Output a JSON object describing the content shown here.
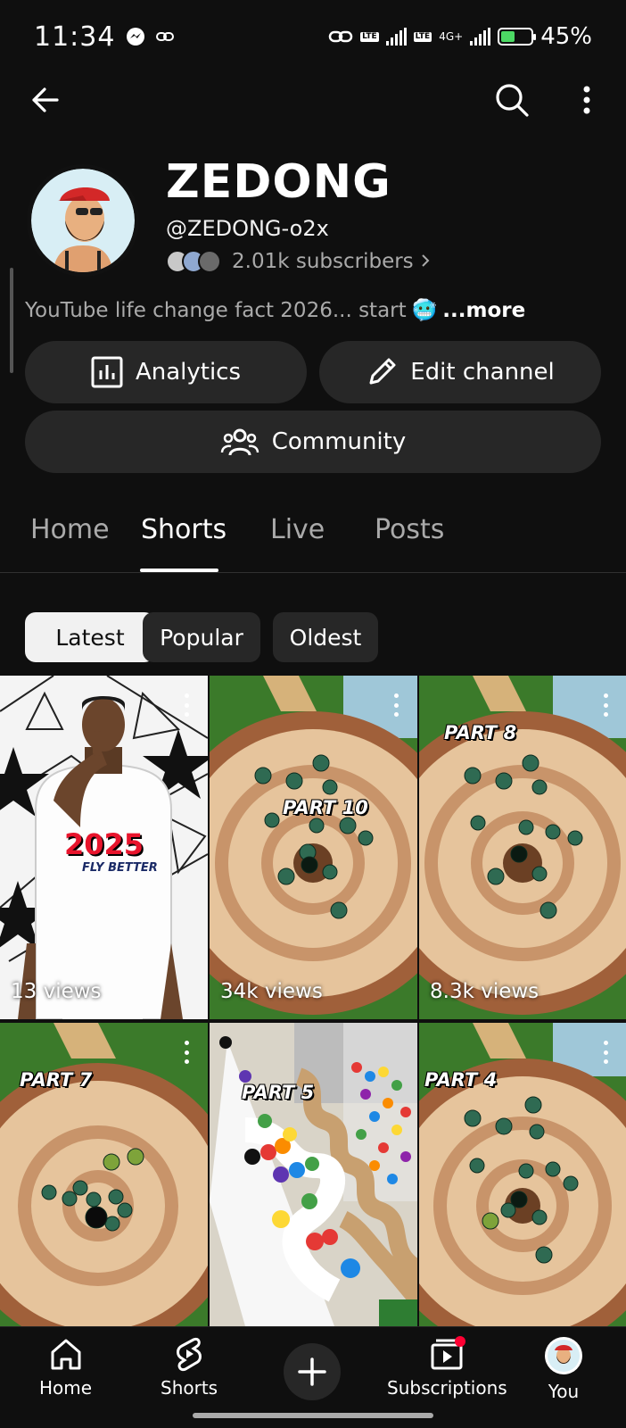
{
  "status_bar": {
    "time": "11:34",
    "battery_percent": "45%",
    "battery_level": 0.45,
    "network_label": "4G+"
  },
  "top_bar": {
    "back_icon": "arrow-left-icon",
    "search_icon": "search-icon",
    "menu_icon": "more-vert-icon"
  },
  "channel": {
    "name": "ZEDONG",
    "handle": "@ZEDONG-o2x",
    "subscribers": "2.01k subscribers",
    "description": "YouTube life change fact 2026... start",
    "description_emoji": "🥶",
    "more_label": "...more"
  },
  "actions": {
    "analytics_label": "Analytics",
    "edit_channel_label": "Edit channel",
    "community_label": "Community"
  },
  "tabs": [
    {
      "label": "Home"
    },
    {
      "label": "Shorts"
    },
    {
      "label": "Live"
    },
    {
      "label": "Posts"
    }
  ],
  "active_tab": "Shorts",
  "chips": [
    {
      "label": "Latest"
    },
    {
      "label": "Popular"
    },
    {
      "label": "Oldest"
    }
  ],
  "selected_chip": "Latest",
  "shorts": [
    {
      "overlay_text": "2025",
      "overlay_sub": "FLY BETTER",
      "views": "13 views"
    },
    {
      "overlay_text": "PART 10",
      "views": "34k views"
    },
    {
      "overlay_text": "PART 8",
      "views": "8.3k views"
    },
    {
      "overlay_text": "PART 7",
      "views": ""
    },
    {
      "overlay_text": "PART 5",
      "views": ""
    },
    {
      "overlay_text": "PART 4",
      "views": ""
    }
  ],
  "bottom_nav": [
    {
      "label": "Home",
      "icon": "home-icon"
    },
    {
      "label": "Shorts",
      "icon": "shorts-icon"
    },
    {
      "label": "",
      "icon": "add-icon"
    },
    {
      "label": "Subscriptions",
      "icon": "subscriptions-icon"
    },
    {
      "label": "You",
      "icon": "avatar"
    }
  ],
  "colors": {
    "background": "#0f0f0f",
    "surface": "#272727",
    "accent_red": "#ff0033"
  }
}
